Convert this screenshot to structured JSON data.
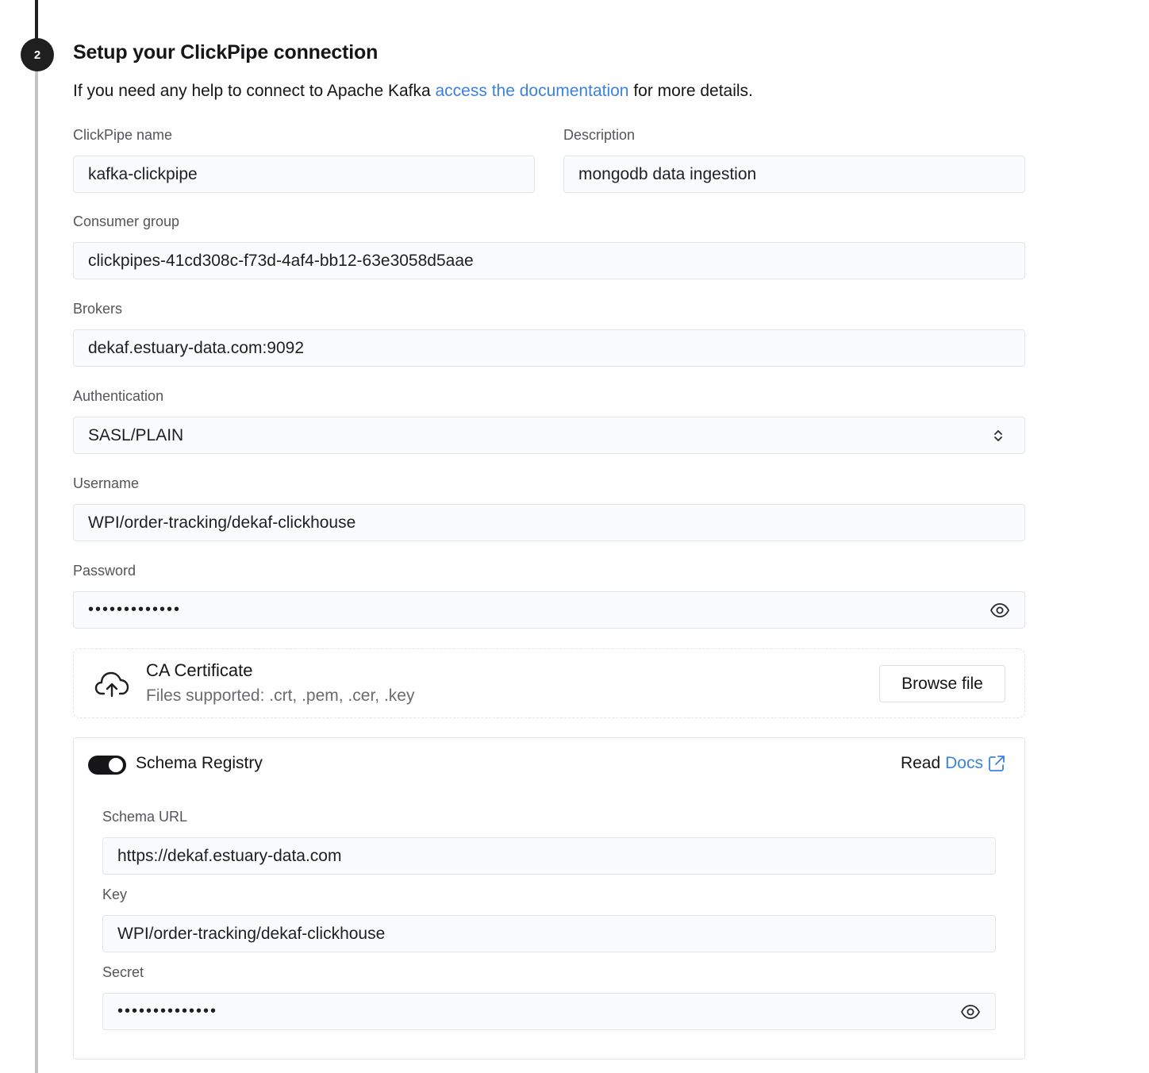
{
  "step": {
    "number": "2",
    "title": "Setup your ClickPipe connection",
    "help_prefix": "If you need any help to connect to Apache Kafka ",
    "help_link": "access the documentation",
    "help_suffix": " for more details."
  },
  "form": {
    "clickpipe_name": {
      "label": "ClickPipe name",
      "value": "kafka-clickpipe"
    },
    "description": {
      "label": "Description",
      "value": "mongodb data ingestion"
    },
    "consumer_group": {
      "label": "Consumer group",
      "value": "clickpipes-41cd308c-f73d-4af4-bb12-63e3058d5aae"
    },
    "brokers": {
      "label": "Brokers",
      "value": "dekaf.estuary-data.com:9092"
    },
    "authentication": {
      "label": "Authentication",
      "value": "SASL/PLAIN"
    },
    "username": {
      "label": "Username",
      "value": "WPI/order-tracking/dekaf-clickhouse"
    },
    "password": {
      "label": "Password",
      "value": "•••••••••••••"
    }
  },
  "certificate": {
    "title": "CA Certificate",
    "supported": "Files supported: .crt, .pem, .cer, .key",
    "browse_label": "Browse file"
  },
  "schema_registry": {
    "toggle_label": "Schema Registry",
    "enabled": true,
    "read_prefix": "Read",
    "docs_link": "Docs",
    "schema_url": {
      "label": "Schema URL",
      "value": "https://dekaf.estuary-data.com"
    },
    "key": {
      "label": "Key",
      "value": "WPI/order-tracking/dekaf-clickhouse"
    },
    "secret": {
      "label": "Secret",
      "value": "••••••••••••••"
    }
  },
  "icons": {
    "eye": "eye-icon",
    "upload": "cloud-upload-icon",
    "select": "chevron-up-down-icon",
    "external": "external-link-icon"
  },
  "colors": {
    "link": "#3b82e0",
    "dark": "#1f1f1f",
    "border": "#e3e4e8"
  }
}
